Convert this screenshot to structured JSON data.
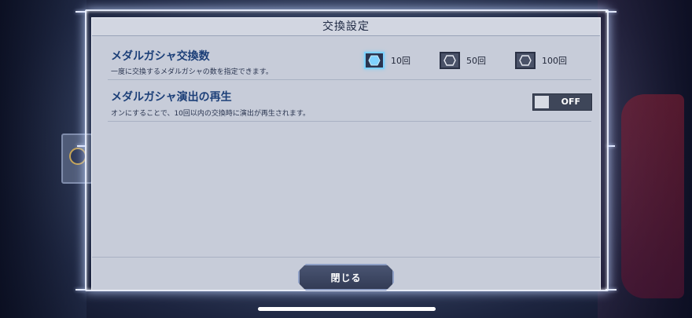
{
  "dialog": {
    "title": "交換設定",
    "close_label": "閉じる"
  },
  "exchange_count": {
    "title": "メダルガシャ交換数",
    "description": "一度に交換するメダルガシャの数を指定できます。",
    "options": [
      {
        "label": "10回",
        "selected": true
      },
      {
        "label": "50回",
        "selected": false
      },
      {
        "label": "100回",
        "selected": false
      }
    ]
  },
  "animation": {
    "title": "メダルガシャ演出の再生",
    "description": "オンにすることで、10回以内の交換時に演出が再生されます。",
    "toggle_label": "OFF",
    "toggle_on": false
  },
  "colors": {
    "accent_title": "#1c3f78",
    "selected_glow": "#7fd2ff",
    "panel_bg": "#c7ccd9"
  },
  "icons": {
    "option": "hexagon-icon"
  }
}
